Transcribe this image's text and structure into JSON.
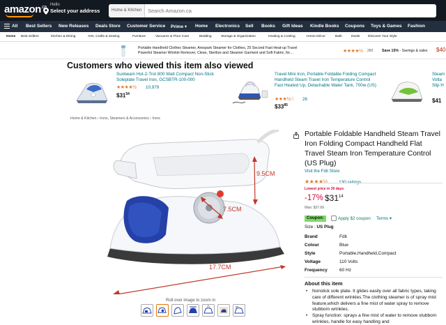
{
  "nav": {
    "logo": "amazon",
    "logo_tld": ".ca",
    "location_line1": "Hello",
    "location_line2": "Select your address",
    "search_category": "Home & Kitchen ▾",
    "search_placeholder": "Search Amazon.ca",
    "main_items": [
      "All",
      "Best Sellers",
      "New Releases",
      "Deals Store",
      "Customer Service",
      "Prime ▾",
      "Home",
      "Electronics",
      "Sell",
      "Books",
      "Gift Ideas",
      "Kindle Books",
      "Coupons",
      "Toys & Games",
      "Fashion"
    ],
    "sub_items": [
      "Home",
      "Best Sellers",
      "Kitchen & Dining",
      "Arts, Crafts & Sewing",
      "Furniture",
      "Vacuums & Floor Care",
      "Bedding",
      "Storage & Organization",
      "Heating & Cooling",
      "Home Décor",
      "Bath",
      "Deals",
      "Discover Your Style"
    ]
  },
  "banner": {
    "line1": "Portable Handheld Clothes Steamer, Arespark Steamer for Clothes, 25 Second Fast Heat-up Travel",
    "line2": "Powerful Steamer Wrinkle Remover, Clean, Sterilize and Steamer Garment and Soft Fabric, for…",
    "stars": "★★★★½",
    "rating_count": "260",
    "save_bold": "Save 15%",
    "save_rest": " - Savings & sales",
    "price": "$40"
  },
  "also_viewed": {
    "title": "Customers who viewed this item also viewed",
    "cards": [
      {
        "title": "Sunbeam Hot-2-Trot 800 Watt Compact Non-Stick Soleplate Travel Iron, GCSBTR-100-000",
        "stars": "★★★★½",
        "count": "10,979",
        "price_main": "$31",
        "price_cents": "54"
      },
      {
        "title": "Travel Mini Iron, Portable Foldable Folding Compact Handheld Steam Travel Iron Temperature Control Fast Heated Up, Detachable Water Tank, 700w (US)",
        "stars": "★★★½☆",
        "count": "26",
        "price_main": "$33",
        "price_cents": "85"
      },
      {
        "title": "Steam Volta Slip H",
        "stars": "★★★★",
        "count": "",
        "price_main": "$41",
        "price_cents": "0"
      }
    ]
  },
  "breadcrumb": "Home & Kitchen  ›  Irons, Steamers & Accessories  ›  Irons",
  "image": {
    "dim_height": "9.5CM",
    "dim_width": "7.5CM",
    "dim_length": "17.7CM",
    "zoom_hint": "Roll over image to zoom in"
  },
  "product": {
    "title": "Portable Foldable Handheld Steam Travel Iron Folding Compact Handheld Flat Travel Steam Iron Temperature Control (US Plug)",
    "store": "Visit the Fdit Store",
    "stars": "★★★★½",
    "rating_count": "130 ratings",
    "low_price_label": "Lowest price in 30 days",
    "discount": "-17%",
    "price_main": "$31",
    "price_cents": "14",
    "was": "Was: $37.69",
    "coupon_badge": "Coupon:",
    "coupon_text": "Apply $2 coupon",
    "coupon_terms": "Terms ▾",
    "size_label": "Size : ",
    "size_value": "US Plug",
    "specs": [
      {
        "k": "Brand",
        "v": "Fdit"
      },
      {
        "k": "Colour",
        "v": "Blue"
      },
      {
        "k": "Style",
        "v": "Portable,Handheld,Compact"
      },
      {
        "k": "Voltage",
        "v": "110 Volts"
      },
      {
        "k": "Frequency",
        "v": "60 Hz"
      }
    ],
    "about_title": "About this item",
    "about": [
      "Nonstick sole plate. It glides easily over all fabric types, taking care of different wrinkles.The clothing steamer is of spray mist feature,which delivers a fine mist of water spray to remove stubborn wrinkles.",
      "Spray function: sprays a fine mist of water to remove stubborn wrinkles, handle for easy handling and"
    ]
  },
  "colors": {
    "nav_dark": "#131921",
    "nav_mid": "#232f3e",
    "accent": "#ff9900",
    "price_red": "#cc0c39",
    "link": "#007185",
    "iron_blue": "#2541a8"
  }
}
